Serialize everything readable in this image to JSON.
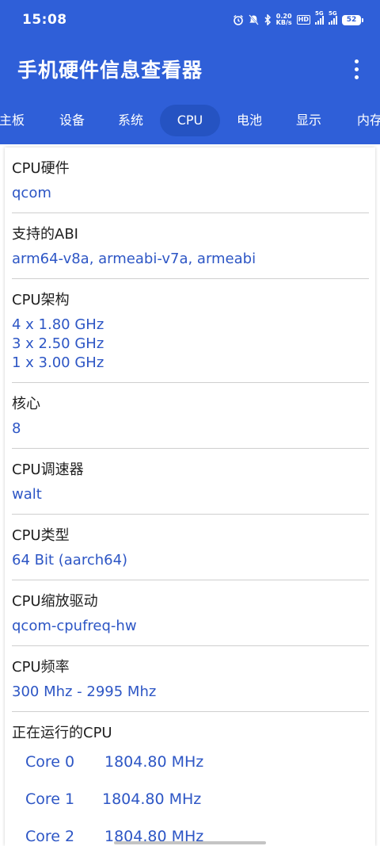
{
  "status_bar": {
    "time": "15:08",
    "net_speed_value": "0.20",
    "net_speed_unit": "KB/s",
    "hd_badge": "HD",
    "signal_1": "5G",
    "signal_2": "5G",
    "battery": "52"
  },
  "app_bar": {
    "title": "手机硬件信息查看器"
  },
  "tabs": [
    {
      "label": "主板"
    },
    {
      "label": "设备"
    },
    {
      "label": "系统"
    },
    {
      "label": "CPU",
      "active": true
    },
    {
      "label": "电池"
    },
    {
      "label": "显示"
    },
    {
      "label": "内存"
    }
  ],
  "sections": [
    {
      "label": "CPU硬件",
      "value": "qcom"
    },
    {
      "label": "支持的ABI",
      "value": "arm64-v8a, armeabi-v7a, armeabi"
    },
    {
      "label": "CPU架构",
      "value": "4 x 1.80 GHz\n3 x 2.50 GHz\n1 x 3.00 GHz"
    },
    {
      "label": "核心",
      "value": "8"
    },
    {
      "label": "CPU调速器",
      "value": "walt"
    },
    {
      "label": "CPU类型",
      "value": "64 Bit (aarch64)"
    },
    {
      "label": "CPU缩放驱动",
      "value": "qcom-cpufreq-hw"
    },
    {
      "label": "CPU频率",
      "value": "300 Mhz - 2995 Mhz"
    }
  ],
  "running": {
    "label": "正在运行的CPU",
    "cores": [
      {
        "name": "Core 0",
        "freq": "1804.80 MHz"
      },
      {
        "name": "Core 1",
        "freq": "1804.80 MHz"
      },
      {
        "name": "Core 2",
        "freq": "1804.80 MHz"
      }
    ]
  },
  "colors": {
    "primary": "#2f5fd8",
    "tab_active": "#2553c2",
    "value_text": "#2d56c5",
    "divider": "#cfcfcf"
  }
}
